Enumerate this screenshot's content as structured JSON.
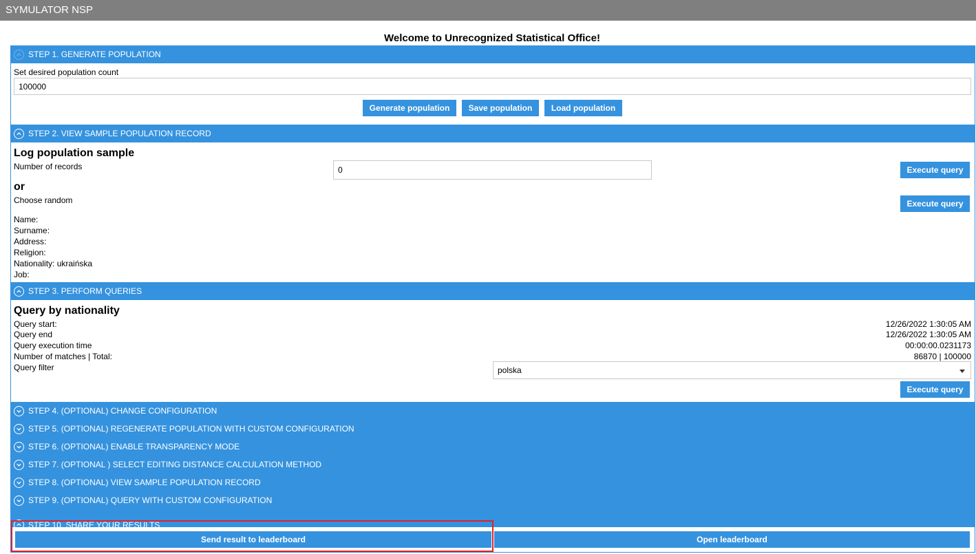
{
  "app": {
    "title": "SYMULATOR NSP"
  },
  "welcome": "Welcome to Unrecognized Statistical Office!",
  "step1": {
    "header": "STEP 1. GENERATE POPULATION",
    "count_label": "Set desired population count",
    "count_value": "100000",
    "generate_label": "Generate population",
    "save_label": "Save population",
    "load_label": "Load population"
  },
  "step2": {
    "header": "STEP 2. VIEW SAMPLE POPULATION RECORD",
    "title": "Log population sample",
    "records_label": "Number of records",
    "records_value": "0",
    "execute_label": "Execute query",
    "or_label": "or",
    "random_label": "Choose random",
    "execute_random_label": "Execute query",
    "fields": {
      "name": "Name:",
      "surname": "Surname:",
      "address": "Address:",
      "religion": "Religion:",
      "nationality": "Nationality: ukraińska",
      "job": "Job:"
    }
  },
  "step3": {
    "header": "STEP 3. PERFORM QUERIES",
    "title": "Query by nationality",
    "start_label": "Query start:",
    "start_value": "12/26/2022 1:30:05 AM",
    "end_label": "Query end",
    "end_value": "12/26/2022 1:30:05 AM",
    "exec_label": "Query execution time",
    "exec_value": "00:00:00.0231173",
    "matches_label": "Number of matches | Total:",
    "matches_value": "86870 | 100000",
    "filter_label": "Query filter",
    "filter_value": "polska",
    "execute_label": "Execute query"
  },
  "collapsed_steps": [
    "STEP 4. (OPTIONAL) CHANGE CONFIGURATION",
    "STEP 5. (OPTIONAL) REGENERATE POPULATION WITH CUSTOM CONFIGURATION",
    "STEP 6. (OPTIONAL) ENABLE TRANSPARENCY MODE",
    "STEP 7. (OPTIONAL ) SELECT EDITING DISTANCE CALCULATION METHOD",
    "STEP 8. (OPTIONAL) VIEW SAMPLE POPULATION RECORD",
    "STEP 9. (OPTIONAL) QUERY WITH CUSTOM CONFIGURATION"
  ],
  "step10": {
    "header": "STEP 10. SHARE YOUR RESULTS",
    "send_label": "Send result to leaderboard",
    "open_label": "Open leaderboard"
  },
  "colors": {
    "accent": "#3592de",
    "titlebar": "#7f7f7f",
    "highlight": "#e2202a"
  }
}
